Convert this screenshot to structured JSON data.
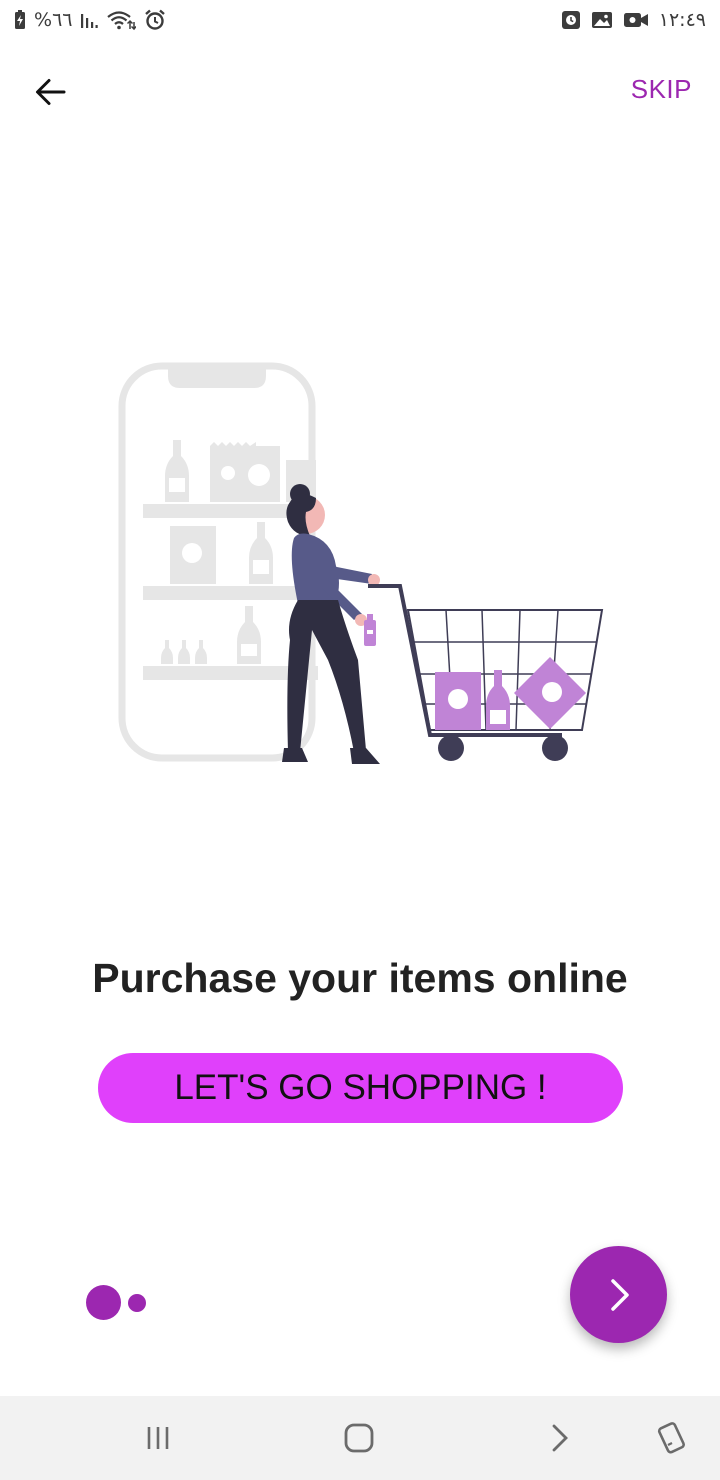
{
  "status_bar": {
    "battery_percent": "%٦٦",
    "time": "١٢:٤٩",
    "icons_left": [
      "battery-charging-icon",
      "signal-icon",
      "wifi-icon",
      "alarm-icon"
    ],
    "icons_right": [
      "screen-record-icon",
      "gallery-icon",
      "video-camera-icon"
    ]
  },
  "app_bar": {
    "back_icon": "arrow-left-icon",
    "skip_label": "SKIP"
  },
  "onboarding": {
    "illustration": "shopping-cart-illustration",
    "headline": "Purchase your items online",
    "cta_label": "LET'S GO SHOPPING !",
    "page_count": 2,
    "current_page": 1,
    "next_icon": "chevron-right-icon"
  },
  "nav_bar": {
    "buttons": [
      "recent-apps-icon",
      "home-icon",
      "back-icon",
      "rotate-icon"
    ]
  },
  "colors": {
    "accent": "#9c27b0",
    "button": "#e040fb",
    "illustration_grey": "#e6e6e6",
    "illustration_purple": "#c084d6",
    "illustration_dark": "#2f2e41",
    "nav_background": "#f2f2f2"
  }
}
